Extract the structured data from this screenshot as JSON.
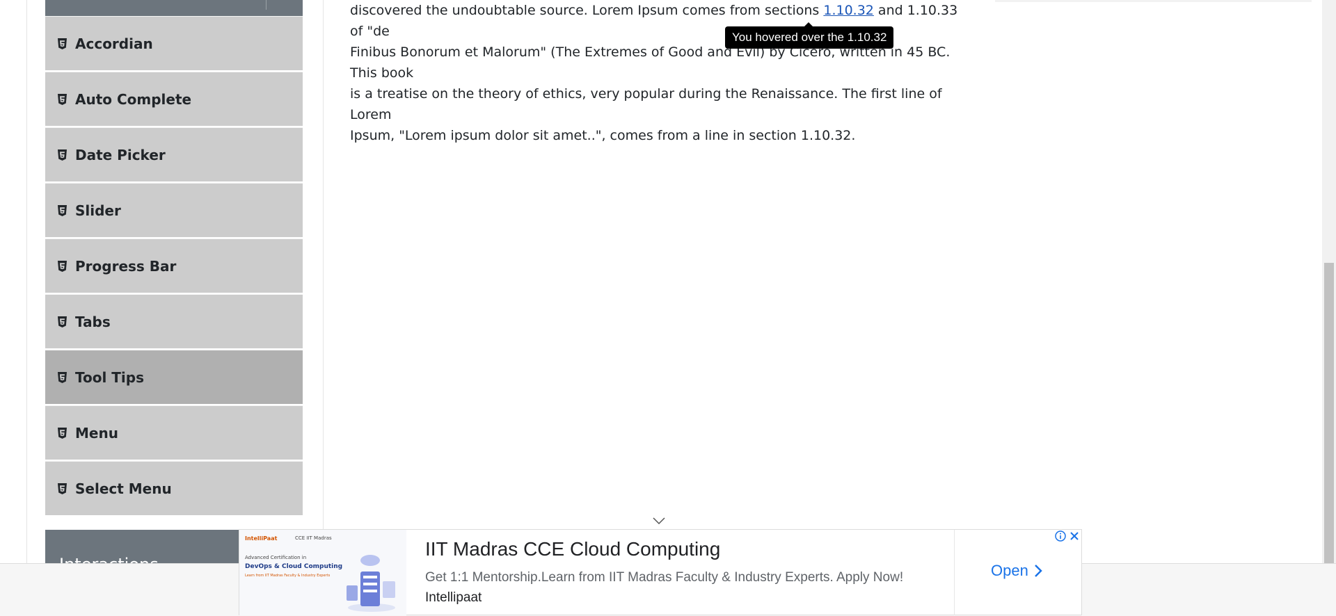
{
  "sidebar": {
    "items": [
      {
        "label": "Accordian"
      },
      {
        "label": "Auto Complete"
      },
      {
        "label": "Date Picker"
      },
      {
        "label": "Slider"
      },
      {
        "label": "Progress Bar"
      },
      {
        "label": "Tabs"
      },
      {
        "label": "Tool Tips",
        "active": true
      },
      {
        "label": "Menu"
      },
      {
        "label": "Select Menu"
      }
    ],
    "next_group": "Interactions"
  },
  "content": {
    "line1_pre": "discovered the undoubtable source. Lorem Ipsum comes from sections ",
    "link_text": "1.10.32",
    "line1_post": " and 1.10.33 of \"de",
    "line2": "Finibus Bonorum et Malorum\" (The Extremes of Good and Evil) by Cicero, written in 45 BC. This book",
    "line3": "is a treatise on the theory of ethics, very popular during the Renaissance. The first line of Lorem",
    "line4": "Ipsum, \"Lorem ipsum dolor sit amet..\", comes from a line in section 1.10.32."
  },
  "tooltip": {
    "text": "You hovered over the 1.10.32"
  },
  "ad": {
    "title": "IIT Madras CCE Cloud Computing",
    "description": "Get 1:1 Mentorship.Learn from IIT Madras Faculty & Industry Experts. Apply Now!",
    "brand": "Intellipaat",
    "cta": "Open",
    "thumb_brand": "IntelliPaat",
    "thumb_partner": "CCE IIT Madras",
    "thumb_line1": "Advanced Certification in",
    "thumb_line2": "DevOps & Cloud Computing",
    "thumb_line3": "Learn from IIT Madras Faculty & Industry Experts"
  },
  "colors": {
    "nav_bg": "#cccccc",
    "nav_active_bg": "#b0b0b0",
    "header_bg": "#6c757d",
    "link": "#1a55b7",
    "ad_cta": "#1a73e8"
  }
}
